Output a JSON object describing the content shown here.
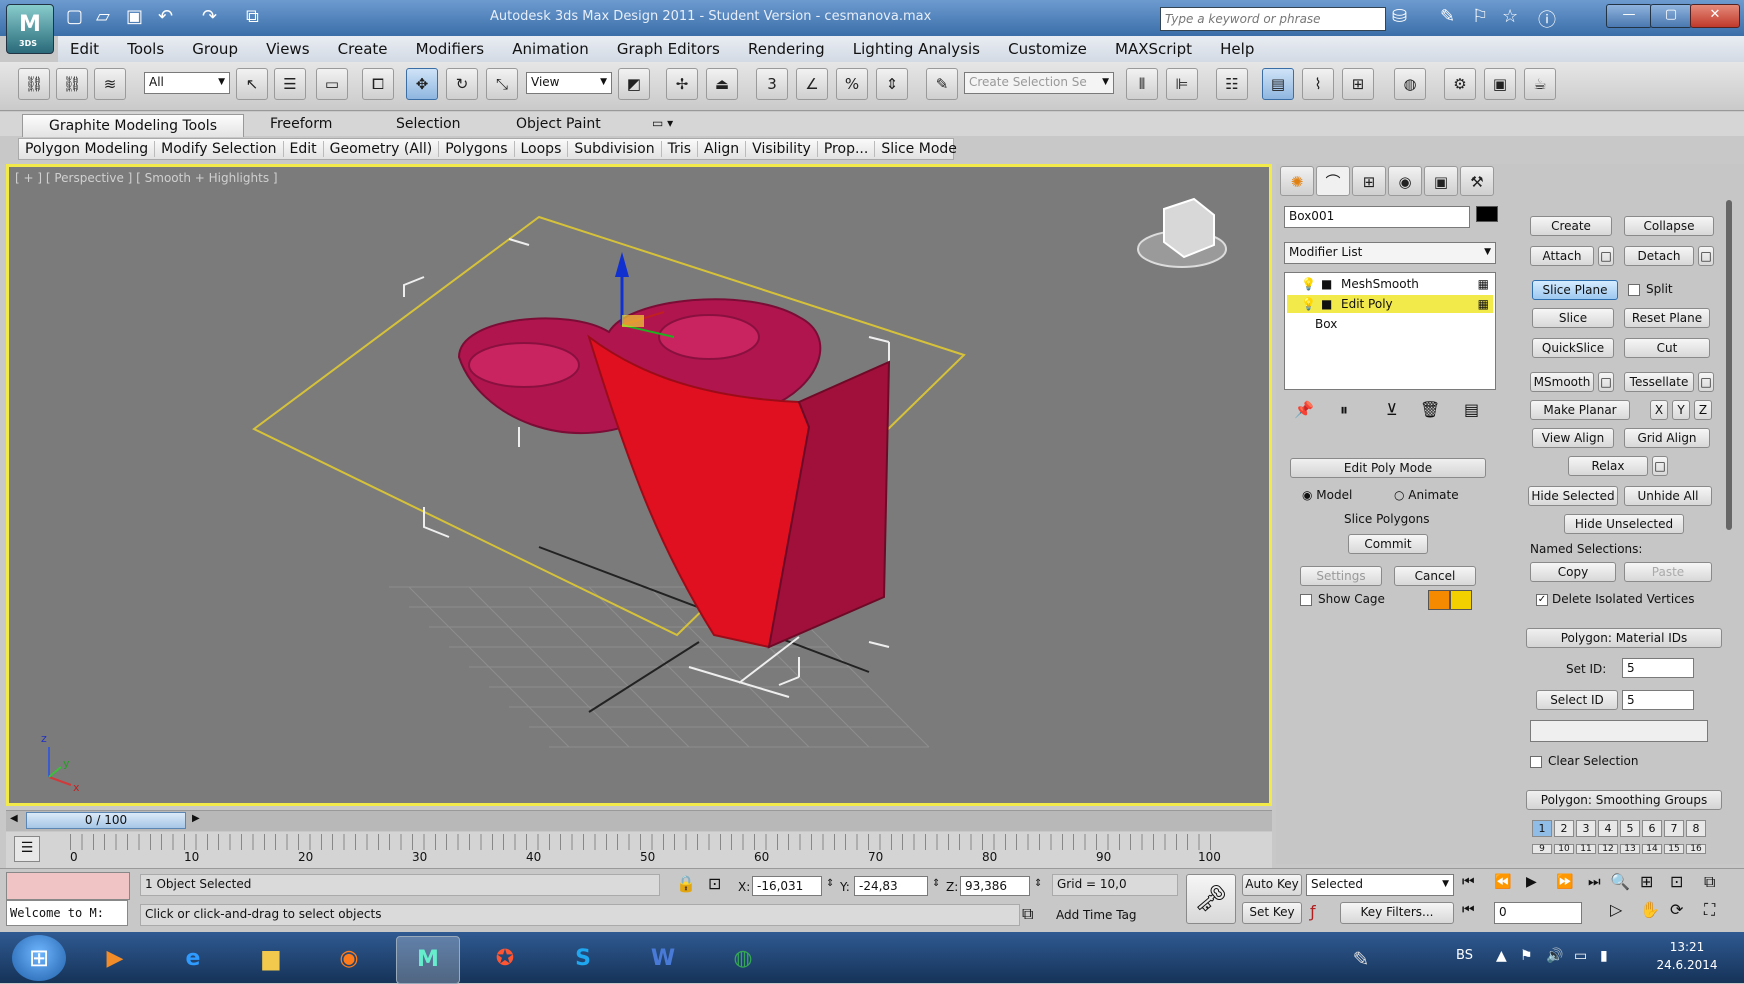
{
  "window": {
    "title": "Autodesk 3ds Max Design 2011  -  Student Version  -  cesmanova.max",
    "search_placeholder": "Type a keyword or phrase",
    "app_badge": "3DS"
  },
  "menu": [
    "Edit",
    "Tools",
    "Group",
    "Views",
    "Create",
    "Modifiers",
    "Animation",
    "Graph Editors",
    "Rendering",
    "Lighting Analysis",
    "Customize",
    "MAXScript",
    "Help"
  ],
  "toolbar": {
    "selection_filter": "All",
    "ref_coord": "View",
    "named_selection_placeholder": "Create Selection Se",
    "snap_labels": [
      "3",
      "%"
    ]
  },
  "ribbon": {
    "tabs": [
      "Graphite Modeling Tools",
      "Freeform",
      "Selection",
      "Object Paint"
    ],
    "panels": [
      "Polygon Modeling",
      "Modify Selection",
      "Edit",
      "Geometry (All)",
      "Polygons",
      "Loops",
      "Subdivision",
      "Tris",
      "Align",
      "Visibility",
      "Prop...",
      "Slice Mode"
    ]
  },
  "viewport": {
    "label": "[ + ] [ Perspective ] [ Smooth + Highlights ]",
    "axis_x": "x",
    "axis_y": "y",
    "axis_z": "z"
  },
  "command_panel": {
    "object_name": "Box001",
    "modifier_list": "Modifier List",
    "stack": [
      "MeshSmooth",
      "Edit Poly",
      "Box"
    ],
    "edit_poly_mode": {
      "title": "Edit Poly Mode",
      "model": "Model",
      "animate": "Animate",
      "current_op": "Slice Polygons",
      "commit": "Commit",
      "settings": "Settings",
      "cancel": "Cancel",
      "show_cage": "Show Cage"
    },
    "edit_geometry": {
      "create": "Create",
      "collapse": "Collapse",
      "attach": "Attach",
      "detach": "Detach",
      "slice_plane": "Slice Plane",
      "split": "Split",
      "slice": "Slice",
      "reset_plane": "Reset Plane",
      "quickslice": "QuickSlice",
      "cut": "Cut",
      "msmooth": "MSmooth",
      "tessellate": "Tessellate",
      "make_planar": "Make Planar",
      "x": "X",
      "y": "Y",
      "z": "Z",
      "view_align": "View Align",
      "grid_align": "Grid Align",
      "relax": "Relax",
      "hide_selected": "Hide Selected",
      "unhide_all": "Unhide All",
      "hide_unselected": "Hide Unselected",
      "named_selections": "Named Selections:",
      "copy": "Copy",
      "paste": "Paste",
      "delete_isolated": "Delete Isolated Vertices"
    },
    "material_ids": {
      "title": "Polygon: Material IDs",
      "set_id_label": "Set ID:",
      "set_id_value": "5",
      "select_id": "Select ID",
      "select_id_value": "5",
      "clear_selection": "Clear Selection"
    },
    "smoothing_groups": {
      "title": "Polygon: Smoothing Groups",
      "groups": [
        "1",
        "2",
        "3",
        "4",
        "5",
        "6",
        "7",
        "8"
      ],
      "groups_row2": [
        "9",
        "10",
        "11",
        "12",
        "13",
        "14",
        "15",
        "16"
      ]
    }
  },
  "timeline": {
    "frame": "0 / 100",
    "ticks": [
      "0",
      "10",
      "20",
      "30",
      "40",
      "50",
      "60",
      "70",
      "80",
      "90",
      "100"
    ]
  },
  "status": {
    "objects": "1 Object Selected",
    "prompt": "Click or click-and-drag to select objects",
    "listener": "Welcome to M:",
    "x_label": "X:",
    "x": "-16,031",
    "y_label": "Y:",
    "y": "-24,83",
    "z_label": "Z:",
    "z": "93,386",
    "grid": "Grid = 10,0",
    "add_time_tag": "Add Time Tag",
    "auto_key": "Auto Key",
    "set_key": "Set Key",
    "key_mode": "Selected",
    "key_filters": "Key Filters...",
    "frame_field": "0"
  },
  "taskbar": {
    "lang": "BS",
    "time": "13:21",
    "date": "24.6.2014"
  },
  "colors": {
    "title_bar": "#3b6ea8",
    "viewport_bg": "#7a7a7a",
    "mesh_red": "#e01020",
    "mesh_magenta": "#b0154e",
    "highlight_yellow": "#f2e94a",
    "taskbar": "#1e3f6e"
  }
}
